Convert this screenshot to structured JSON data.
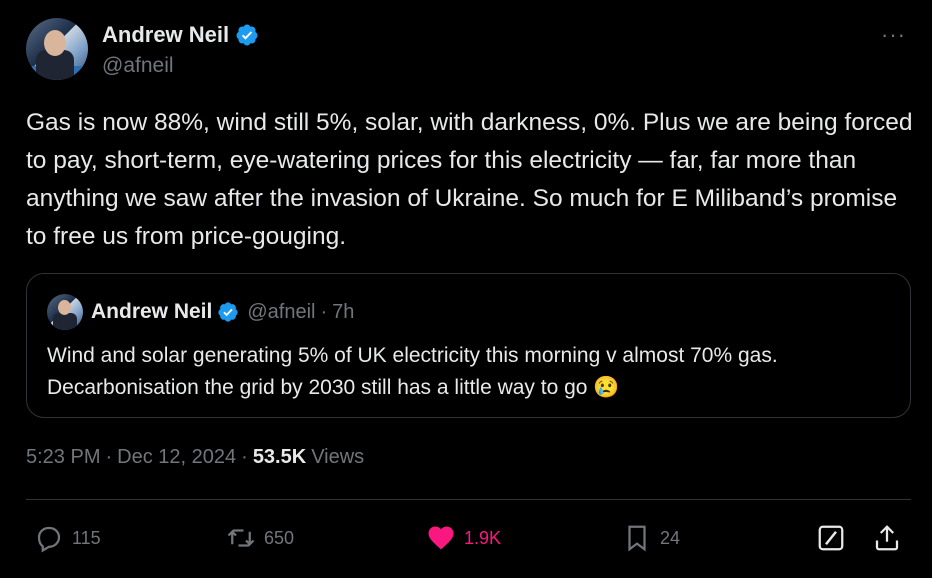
{
  "author": {
    "name": "Andrew Neil",
    "handle": "@afneil"
  },
  "more_menu": "···",
  "tweet": {
    "text": "Gas is now 88%, wind still 5%, solar, with darkness, 0%. Plus we are being forced to pay, short-term, eye-watering prices for this electricity — far, far more than anything we saw after the invasion of Ukraine. So much for E Miliband’s promise to free us from price-gouging."
  },
  "quoted": {
    "name": "Andrew Neil",
    "handle": "@afneil",
    "dot": "·",
    "time": "7h",
    "text": "Wind and solar generating 5% of UK electricity this morning v almost 70% gas. Decarbonisation the grid by 2030 still has a little way to go 😢"
  },
  "meta": {
    "time": "5:23 PM",
    "sep1": "·",
    "date": "Dec 12, 2024",
    "sep2": "·",
    "views_count": "53.5K",
    "views_label": "Views"
  },
  "actions": {
    "replies": "115",
    "reposts": "650",
    "likes": "1.9K",
    "bookmarks": "24"
  },
  "colors": {
    "background": "#000000",
    "text": "#e7e9ea",
    "secondary": "#71767b",
    "verified": "#1d9bf0",
    "like": "#f91880",
    "border": "#2f3336"
  }
}
